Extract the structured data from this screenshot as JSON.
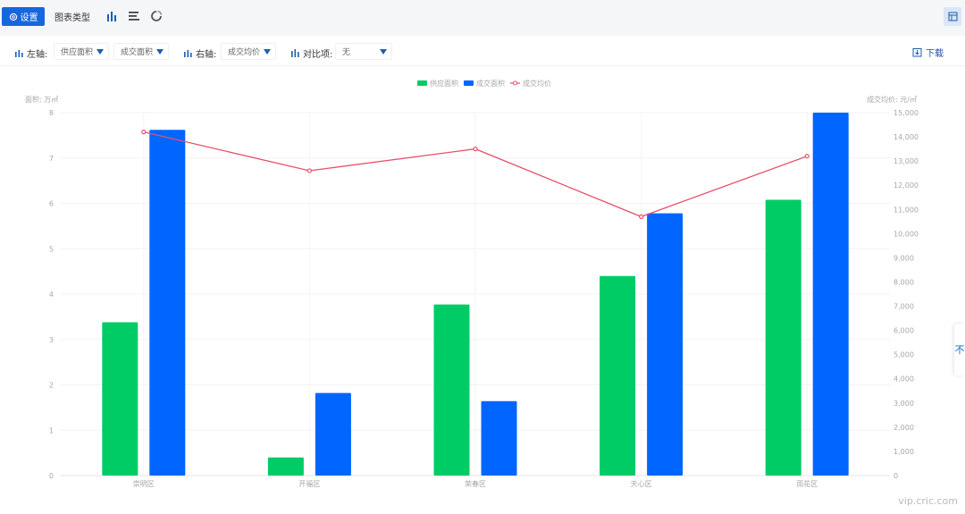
{
  "toolbar": {
    "settings_label": "设置",
    "chart_type_label": "图表类型"
  },
  "filters": {
    "left_axis_label": "左轴:",
    "left_axis_values": [
      "供应面积",
      "成交面积"
    ],
    "right_axis_label": "右轴:",
    "right_axis_value": "成交均价",
    "compare_label": "对比项:",
    "compare_value": "无",
    "download_label": "下载"
  },
  "side_tab": "不",
  "watermark": "vip.cric.com",
  "colors": {
    "supply": "#00cc66",
    "deal": "#0066ff",
    "price": "#e8506a",
    "accent": "#1666e0"
  },
  "chart_data": {
    "type": "bar",
    "categories": [
      "崇明区",
      "开福区",
      "荣春区",
      "天心区",
      "雨花区"
    ],
    "series": [
      {
        "name": "供应面积",
        "type": "bar",
        "axis": "left",
        "values": [
          3.38,
          0.4,
          3.77,
          4.4,
          6.08
        ]
      },
      {
        "name": "成交面积",
        "type": "bar",
        "axis": "left",
        "values": [
          7.62,
          1.82,
          1.64,
          5.78,
          8.0
        ]
      },
      {
        "name": "成交均价",
        "type": "line",
        "axis": "right",
        "values": [
          14200,
          12600,
          13500,
          10700,
          13200
        ]
      }
    ],
    "ylabel": "面积: 万㎡",
    "y2label": "成交均价: 元/㎡",
    "ylim": [
      0,
      8
    ],
    "y2lim": [
      0,
      15000
    ],
    "yticks": [
      "0",
      "1",
      "2",
      "3",
      "4",
      "5",
      "6",
      "7",
      "8"
    ],
    "y2ticks": [
      "0",
      "1,000",
      "2,000",
      "3,000",
      "4,000",
      "5,000",
      "6,000",
      "7,000",
      "8,000",
      "9,000",
      "10,000",
      "11,000",
      "12,000",
      "13,000",
      "14,000",
      "15,000"
    ],
    "legend": "top-center",
    "grid": true
  }
}
